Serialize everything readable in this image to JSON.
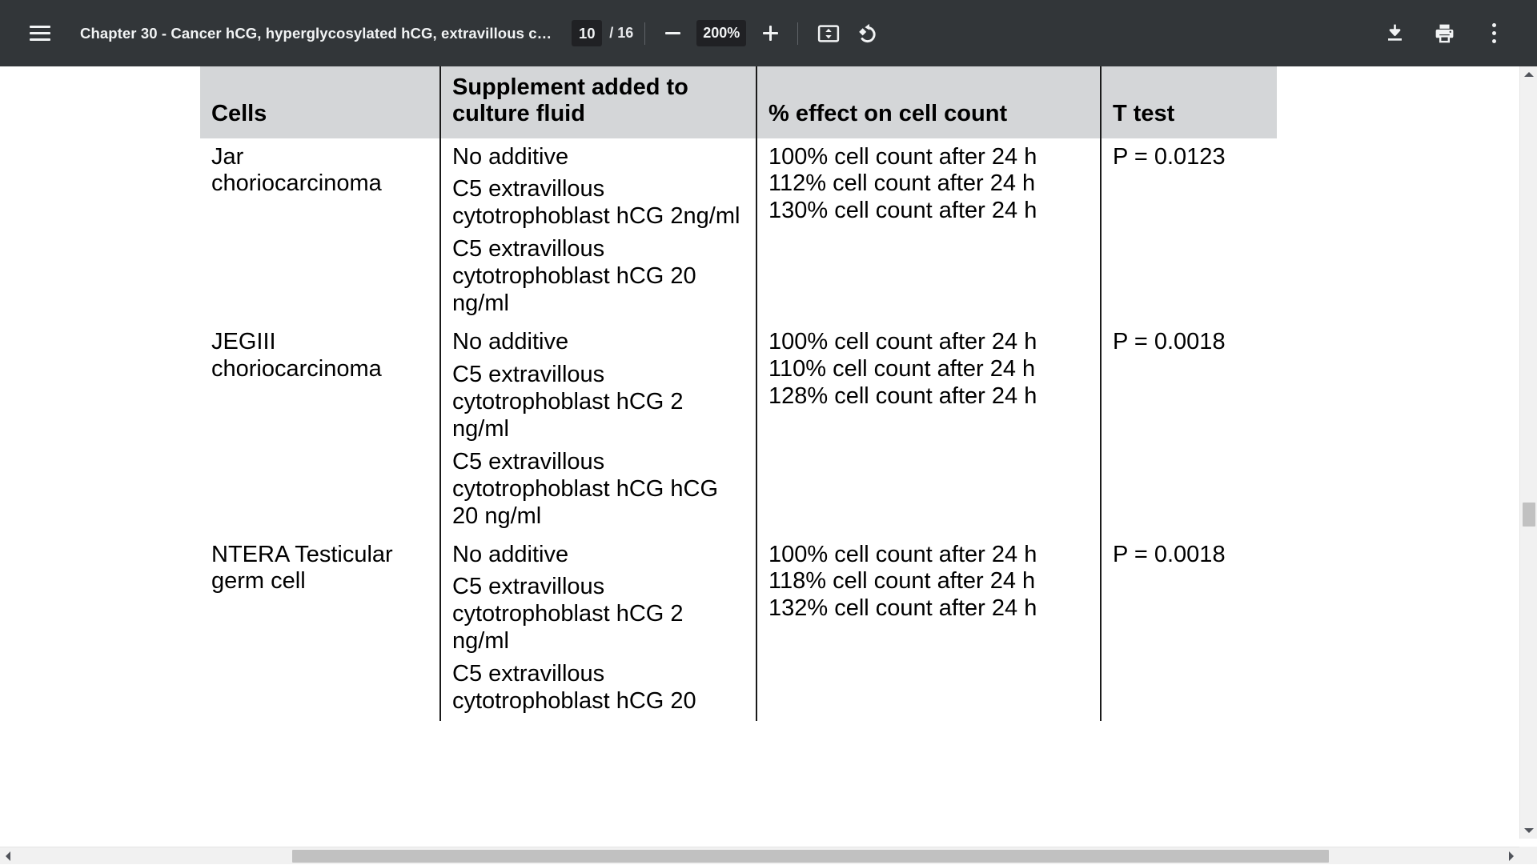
{
  "toolbar": {
    "menu_icon": "hamburger-menu-icon",
    "title": "Chapter 30 - Cancer hCG, hyperglycosylated hCG, extravillous c…",
    "page_number": "10",
    "page_count": "/ 16",
    "zoom_out_icon": "minus-icon",
    "zoom_level": "200%",
    "zoom_in_icon": "plus-icon",
    "fit_icon": "fit-to-page-icon",
    "rotate_icon": "rotate-counterclockwise-icon",
    "download_icon": "download-icon",
    "print_icon": "print-icon",
    "more_icon": "more-options-icon",
    "background": "#323639",
    "text_color": "#f1f3f4",
    "field_background": "#202124"
  },
  "document": {
    "table": {
      "header_background": "#d4d6d8",
      "border_color": "#1a1a1a",
      "headers": [
        "Cells",
        "Supplement added to culture fluid",
        "% effect on cell count",
        "T test"
      ],
      "rows": [
        {
          "cells": [
            "Jar",
            "choriocarcinoma"
          ],
          "supplements": [
            "No additive",
            "C5 extravillous cytotrophoblast hCG 2ng/ml",
            "C5 extravillous cytotrophoblast hCG 20 ng/ml"
          ],
          "effects": [
            "100% cell count after 24 h",
            "112% cell count after 24 h",
            "130% cell count after 24 h"
          ],
          "ttest": "P = 0.0123"
        },
        {
          "cells": [
            "JEGIII",
            "choriocarcinoma"
          ],
          "supplements": [
            "No additive",
            "C5 extravillous cytotrophoblast hCG 2 ng/ml",
            "C5 extravillous cytotrophoblast hCG hCG 20 ng/ml"
          ],
          "effects": [
            "100% cell count after 24 h",
            "110% cell count after 24 h",
            "128% cell count after 24 h"
          ],
          "ttest": "P = 0.0018"
        },
        {
          "cells": [
            "NTERA Testicular",
            "germ cell"
          ],
          "supplements": [
            "No additive",
            "C5 extravillous cytotrophoblast hCG 2 ng/ml",
            "C5 extravillous cytotrophoblast hCG 20"
          ],
          "effects": [
            "100% cell count after 24 h",
            "118% cell count after 24 h",
            "132% cell count after 24 h"
          ],
          "ttest": "P = 0.0018"
        }
      ]
    }
  },
  "scrollbars": {
    "vertical_up_icon": "scroll-up-arrow-icon",
    "vertical_down_icon": "scroll-down-arrow-icon",
    "horizontal_left_icon": "scroll-left-arrow-icon",
    "horizontal_right_icon": "scroll-right-arrow-icon",
    "track_color": "#f1f1f1",
    "thumb_color": "#c1c1c1"
  }
}
